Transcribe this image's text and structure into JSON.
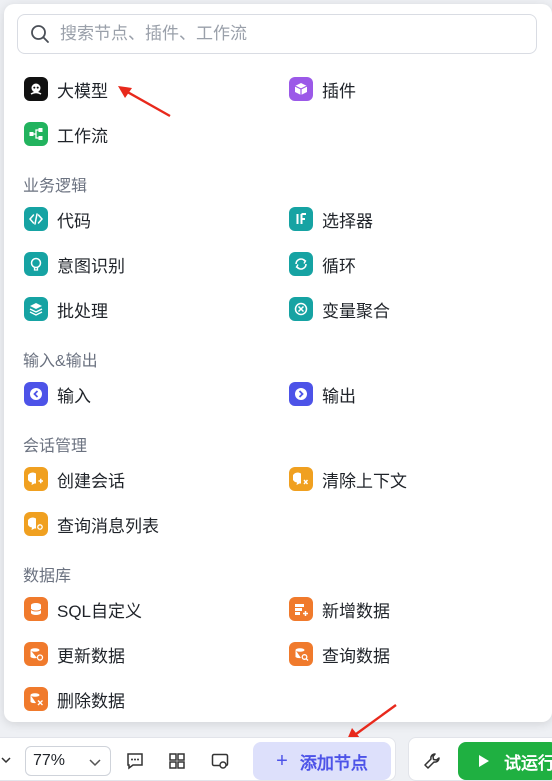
{
  "search": {
    "placeholder": "搜索节点、插件、工作流"
  },
  "top_items": [
    {
      "label": "大模型",
      "icon": "llm-icon",
      "color": "#111111"
    },
    {
      "label": "插件",
      "icon": "plugin-icon",
      "color": "#9b59e8"
    },
    {
      "label": "工作流",
      "icon": "workflow-icon",
      "color": "#22b35e"
    }
  ],
  "sections": [
    {
      "title": "业务逻辑",
      "items": [
        {
          "label": "代码",
          "icon": "code-icon",
          "color": "#16a3a3"
        },
        {
          "label": "选择器",
          "icon": "if-icon",
          "color": "#16a3a3"
        },
        {
          "label": "意图识别",
          "icon": "intent-icon",
          "color": "#16a3a3"
        },
        {
          "label": "循环",
          "icon": "loop-icon",
          "color": "#16a3a3"
        },
        {
          "label": "批处理",
          "icon": "batch-icon",
          "color": "#16a3a3"
        },
        {
          "label": "变量聚合",
          "icon": "variable-merge-icon",
          "color": "#16a3a3"
        }
      ]
    },
    {
      "title": "输入&输出",
      "items": [
        {
          "label": "输入",
          "icon": "input-icon",
          "color": "#4d53e8"
        },
        {
          "label": "输出",
          "icon": "output-icon",
          "color": "#4d53e8"
        }
      ]
    },
    {
      "title": "会话管理",
      "items": [
        {
          "label": "创建会话",
          "icon": "create-conversation-icon",
          "color": "#f0a020"
        },
        {
          "label": "清除上下文",
          "icon": "clear-context-icon",
          "color": "#f0a020"
        },
        {
          "label": "查询消息列表",
          "icon": "message-list-icon",
          "color": "#f0a020"
        }
      ]
    },
    {
      "title": "数据库",
      "items": [
        {
          "label": "SQL自定义",
          "icon": "database-icon",
          "color": "#f07a2c"
        },
        {
          "label": "新增数据",
          "icon": "add-data-icon",
          "color": "#f07a2c"
        },
        {
          "label": "更新数据",
          "icon": "update-data-icon",
          "color": "#f07a2c"
        },
        {
          "label": "查询数据",
          "icon": "query-data-icon",
          "color": "#f07a2c"
        },
        {
          "label": "删除数据",
          "icon": "delete-data-icon",
          "color": "#f07a2c"
        }
      ]
    }
  ],
  "toolbar": {
    "zoom_value": "77%",
    "add_node_label": "添加节点",
    "trial_run_label": "试运行"
  },
  "colors": {
    "accent": "#4d53e8",
    "run": "#1fb041",
    "annotation": "#e8291c"
  }
}
